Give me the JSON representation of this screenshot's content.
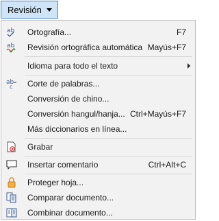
{
  "menu_button": {
    "label": "Revisión"
  },
  "items": [
    {
      "label": "Ortografía...",
      "shortcut": "F7"
    },
    {
      "label": "Revisión ortográfica automática",
      "shortcut": "Mayús+F7"
    },
    {
      "label": "Idioma para todo el texto",
      "shortcut": ""
    },
    {
      "label": "Corte de palabras...",
      "shortcut": ""
    },
    {
      "label": "Conversión de chino...",
      "shortcut": ""
    },
    {
      "label": "Conversión hangul/hanja...",
      "shortcut": "Ctrl+Mayús+F7"
    },
    {
      "label": "Más diccionarios en línea...",
      "shortcut": ""
    },
    {
      "label": "Grabar",
      "shortcut": ""
    },
    {
      "label": "Insertar comentario",
      "shortcut": "Ctrl+Alt+C"
    },
    {
      "label": "Proteger hoja...",
      "shortcut": ""
    },
    {
      "label": "Comparar documento...",
      "shortcut": ""
    },
    {
      "label": "Combinar documento...",
      "shortcut": ""
    }
  ]
}
